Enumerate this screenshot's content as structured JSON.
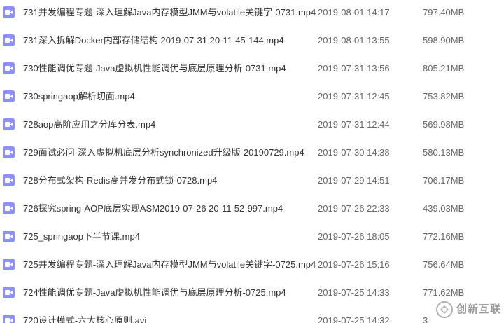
{
  "files": [
    {
      "name": "731并发编程专题-深入理解Java内存模型JMM与volatile关键字-0731.mp4",
      "date": "2019-08-01 14:17",
      "size": "797.40MB"
    },
    {
      "name": "731深入拆解Docker内部存储结构 2019-07-31 20-11-45-144.mp4",
      "date": "2019-08-01 13:55",
      "size": "598.90MB"
    },
    {
      "name": "730性能调优专题-Java虚拟机性能调优与底层原理分析-0731.mp4",
      "date": "2019-07-31 13:56",
      "size": "805.21MB"
    },
    {
      "name": "730springaop解析切面.mp4",
      "date": "2019-07-31 12:45",
      "size": "753.82MB"
    },
    {
      "name": "728aop高阶应用之分库分表.mp4",
      "date": "2019-07-31 12:44",
      "size": "569.98MB"
    },
    {
      "name": "729面试必问-深入虚拟机底层分析synchronized升级版-20190729.mp4",
      "date": "2019-07-30 14:38",
      "size": "580.13MB"
    },
    {
      "name": "728分布式架构-Redis高并发分布式锁-0728.mp4",
      "date": "2019-07-29 14:51",
      "size": "706.17MB"
    },
    {
      "name": "726探究spring-AOP底层实现ASM2019-07-26 20-11-52-997.mp4",
      "date": "2019-07-26 22:33",
      "size": "439.03MB"
    },
    {
      "name": "725_springaop下半节课.mp4",
      "date": "2019-07-26 18:05",
      "size": "772.16MB"
    },
    {
      "name": "725并发编程专题-深入理解Java内存模型JMM与volatile关键字-0725.mp4",
      "date": "2019-07-26 15:16",
      "size": "756.64MB"
    },
    {
      "name": "724性能调优专题-Java虚拟机性能调优与底层原理分析-0725.mp4",
      "date": "2019-07-25 14:33",
      "size": "771.62MB"
    },
    {
      "name": "720设计模式-六大核心原则.avi",
      "date": "2019-07-25 14:32",
      "size": "3"
    }
  ],
  "icon": {
    "name": "video-file-icon",
    "color": "#8f8ffa"
  },
  "watermark": {
    "text": "创新互联"
  }
}
